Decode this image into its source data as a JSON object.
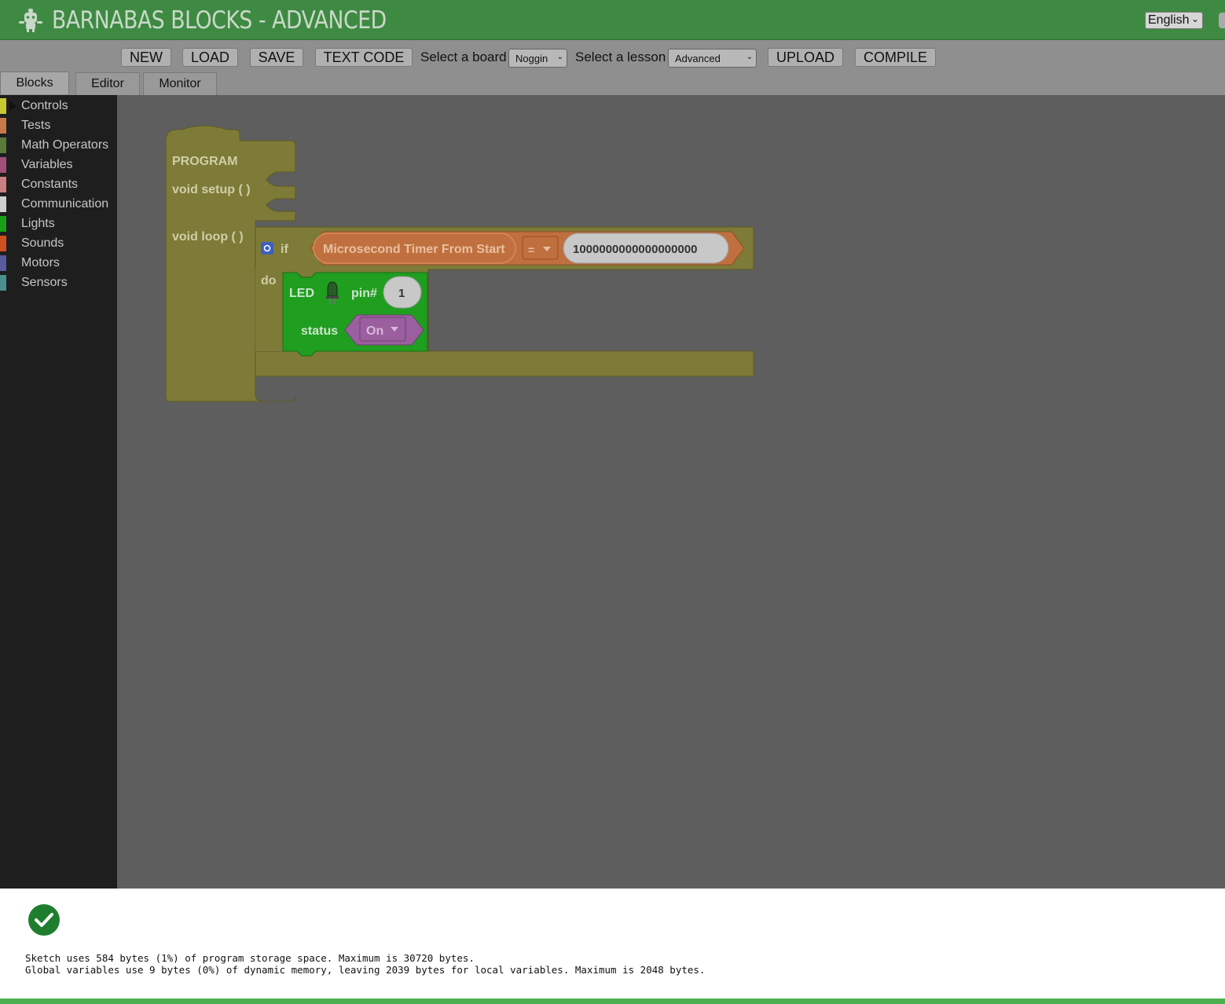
{
  "app": {
    "title": "BARNABAS BLOCKS - ADVANCED",
    "language": "English"
  },
  "toolbar": {
    "new_label": "NEW",
    "load_label": "LOAD",
    "save_label": "SAVE",
    "text_code_label": "TEXT CODE",
    "board_label": "Select a board",
    "board_value": "Noggin",
    "lesson_label": "Select a lesson",
    "lesson_value": "Advanced",
    "upload_label": "UPLOAD",
    "compile_label": "COMPILE"
  },
  "tabs": [
    {
      "label": "Blocks",
      "active": true
    },
    {
      "label": "Editor",
      "active": false
    },
    {
      "label": "Monitor",
      "active": false
    }
  ],
  "categories": [
    {
      "label": "Controls",
      "color": "#c8c832"
    },
    {
      "label": "Tests",
      "color": "#c8794a"
    },
    {
      "label": "Math Operators",
      "color": "#5a7a3a"
    },
    {
      "label": "Variables",
      "color": "#a0507a"
    },
    {
      "label": "Constants",
      "color": "#c88080"
    },
    {
      "label": "Communication",
      "color": "#d0d0d0"
    },
    {
      "label": "Lights",
      "color": "#18a018"
    },
    {
      "label": "Sounds",
      "color": "#d05020"
    },
    {
      "label": "Motors",
      "color": "#5a5aa0"
    },
    {
      "label": "Sensors",
      "color": "#4a9090"
    }
  ],
  "blocks": {
    "program_label": "PROGRAM",
    "setup_label": "void setup ( )",
    "loop_label": "void loop ( )",
    "if_label": "if",
    "do_label": "do",
    "timer_label": "Microsecond Timer From Start",
    "operator": "=",
    "compare_value": "1000000000000000000",
    "led_label": "LED",
    "pin_label": "pin#",
    "pin_value": "1",
    "status_label": "status",
    "status_value": "On",
    "colors": {
      "program": "#7e7a37",
      "test": "#c0703e",
      "light": "#1f9e1f",
      "constant": "#9b5f9f"
    }
  },
  "output": {
    "status": "success",
    "line1": "Sketch uses 584 bytes (1%) of program storage space. Maximum is 30720 bytes.",
    "line2": "Global variables use 9 bytes (0%) of dynamic memory, leaving 2039 bytes for local variables. Maximum is 2048 bytes."
  }
}
